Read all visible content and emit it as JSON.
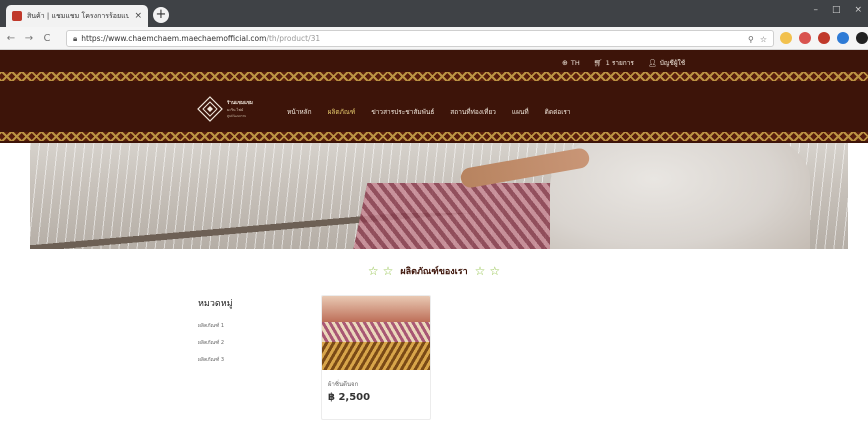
{
  "browser": {
    "tab_title": "สินค้า | แชมแชม โครงการร้อยแปดพันฝ้าย",
    "tab_close": "×",
    "new_tab": "+",
    "win_controls": [
      "–",
      "□",
      "×"
    ],
    "nav": [
      "←",
      "→",
      "C"
    ],
    "url_host": "https://www.chaemchaem.maechaemofficial.com",
    "url_path": "/th/product/31",
    "url_actions": [
      "⚲",
      "☆"
    ]
  },
  "header": {
    "lang": "TH",
    "cart": "1 รายการ",
    "account": "บัญชีผู้ใช้",
    "logo_line1": "ร้านแชมแชม",
    "logo_line2": "มะริน ไฟน์",
    "logo_line3": "ศูนย์วัฒนธรรม"
  },
  "nav": {
    "items": [
      {
        "label": "หน้าหลัก",
        "active": false
      },
      {
        "label": "ผลิตภัณฑ์",
        "active": true
      },
      {
        "label": "ข่าวสารประชาสัมพันธ์",
        "active": false
      },
      {
        "label": "สถานที่ท่องเที่ยว",
        "active": false
      },
      {
        "label": "แผนที่",
        "active": false
      },
      {
        "label": "ติดต่อเรา",
        "active": false
      }
    ]
  },
  "section": {
    "title": "ผลิตภัณฑ์ของเรา"
  },
  "sidebar": {
    "title": "หมวดหมู่",
    "categories": [
      "ผลิตภัณฑ์ 1",
      "ผลิตภัณฑ์ 2",
      "ผลิตภัณฑ์ 3"
    ]
  },
  "products": [
    {
      "name": "ผ้าซิ่นตีนจก",
      "price": "฿ 2,500"
    }
  ],
  "colors": {
    "header_bg": "#3d1409",
    "accent_gold": "#e2c66a",
    "star_green": "#8cbf3f"
  }
}
